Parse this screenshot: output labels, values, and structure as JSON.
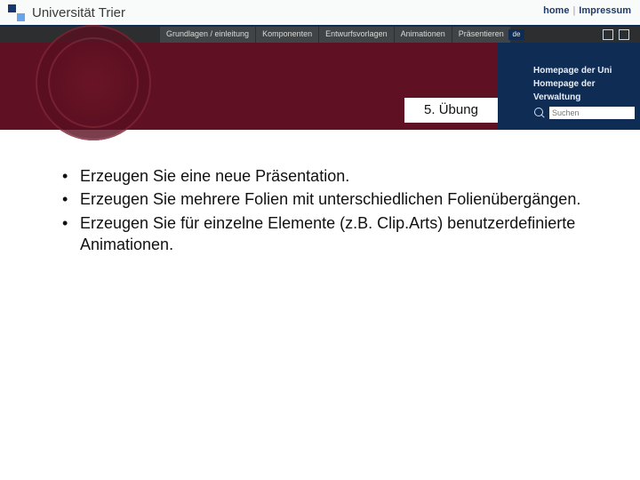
{
  "logo_text": "Universität Trier",
  "top_links": {
    "home": "home",
    "impressum": "Impressum"
  },
  "tabs": [
    "Grundlagen / einleitung",
    "Komponenten",
    "Entwurfsvorlagen",
    "Animationen",
    "Präsentieren"
  ],
  "lang": "de",
  "banner_links": {
    "l1": "Homepage der Uni",
    "l2": "Homepage der Verwaltung"
  },
  "title": "5. Übung",
  "search_placeholder": "Suchen",
  "bullets": [
    "Erzeugen Sie eine neue Präsentation.",
    "Erzeugen Sie mehrere Folien mit unterschiedlichen Folienübergängen.",
    "Erzeugen Sie für einzelne Elemente (z.B. Clip.Arts) benutzerdefinierte Animationen."
  ]
}
